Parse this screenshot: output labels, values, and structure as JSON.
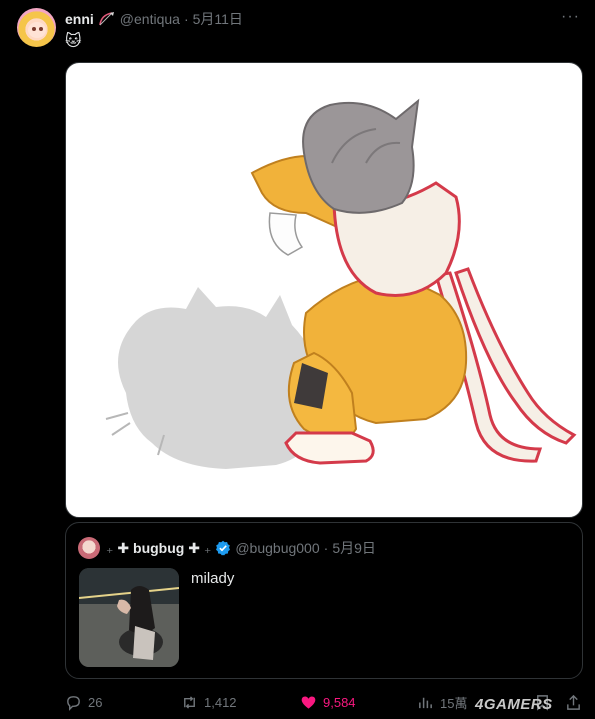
{
  "post": {
    "author_name": "enni",
    "author_handle": "@entiqua",
    "separator": "·",
    "date": "5月11日",
    "text": "🐱",
    "more_icon": "more-dots-icon",
    "media_icon": "illustration"
  },
  "quote": {
    "prefix": "₊",
    "name": "✚ bugbug ✚",
    "suffix": "₊",
    "verified_icon": "verified-badge-icon",
    "handle": "@bugbug000",
    "separator": "·",
    "date": "5月9日",
    "text": "milady"
  },
  "actions": {
    "replies": "26",
    "reposts": "1,412",
    "likes": "9,584",
    "views": "15萬"
  },
  "watermark": "4GAMERS",
  "colors": {
    "background": "#000000",
    "muted": "#71767b",
    "like": "#f91880",
    "verified": "#1d9bf0",
    "border": "#2f3336"
  }
}
